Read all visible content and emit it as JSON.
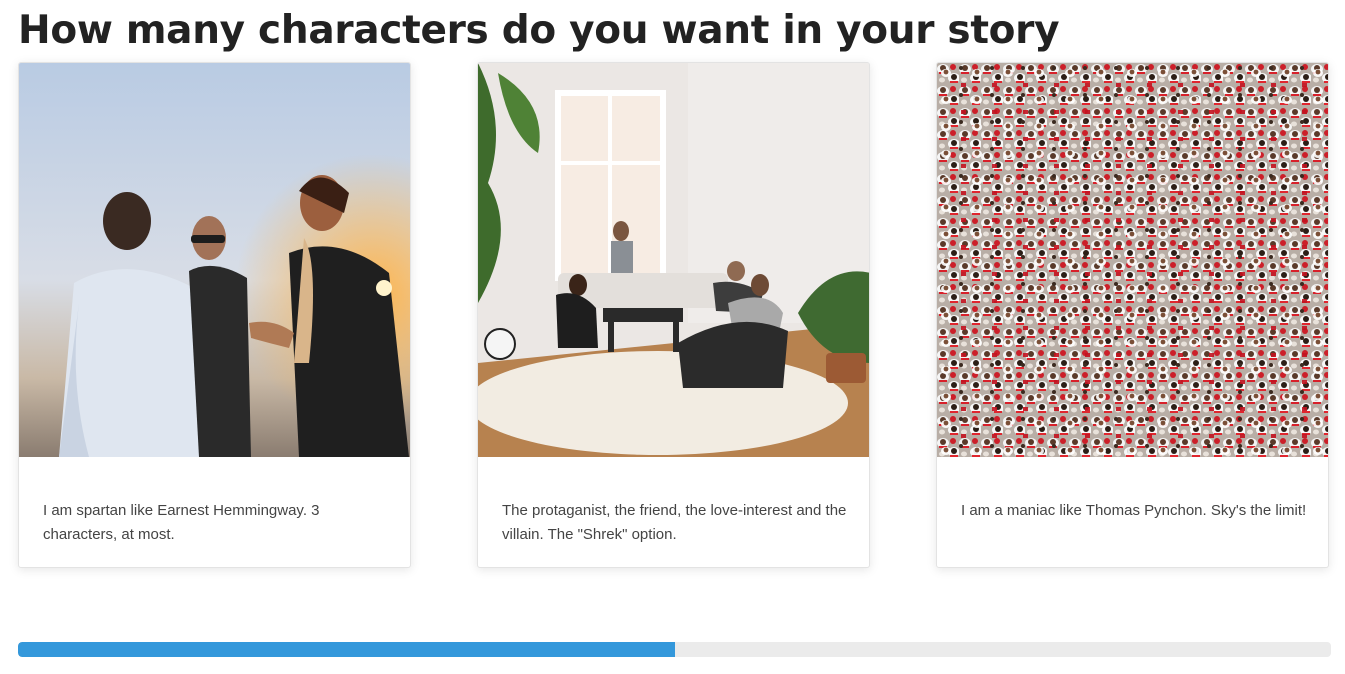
{
  "page": {
    "title": "How many characters do you want in your story"
  },
  "options": [
    {
      "text": "I am spartan like Earnest Hemmingway. 3 characters, at most.",
      "image_icon": "three-friends-photo"
    },
    {
      "text": "The protaganist, the friend, the love-interest and the villain. The \"Shrek\" option.",
      "image_icon": "living-room-group-photo"
    },
    {
      "text": "I am a maniac like Thomas Pynchon. Sky's the limit!",
      "image_icon": "crowd-photo"
    }
  ],
  "progress": {
    "fraction": 0.5,
    "fill_color": "#3498db",
    "track_color": "#ebebeb"
  }
}
